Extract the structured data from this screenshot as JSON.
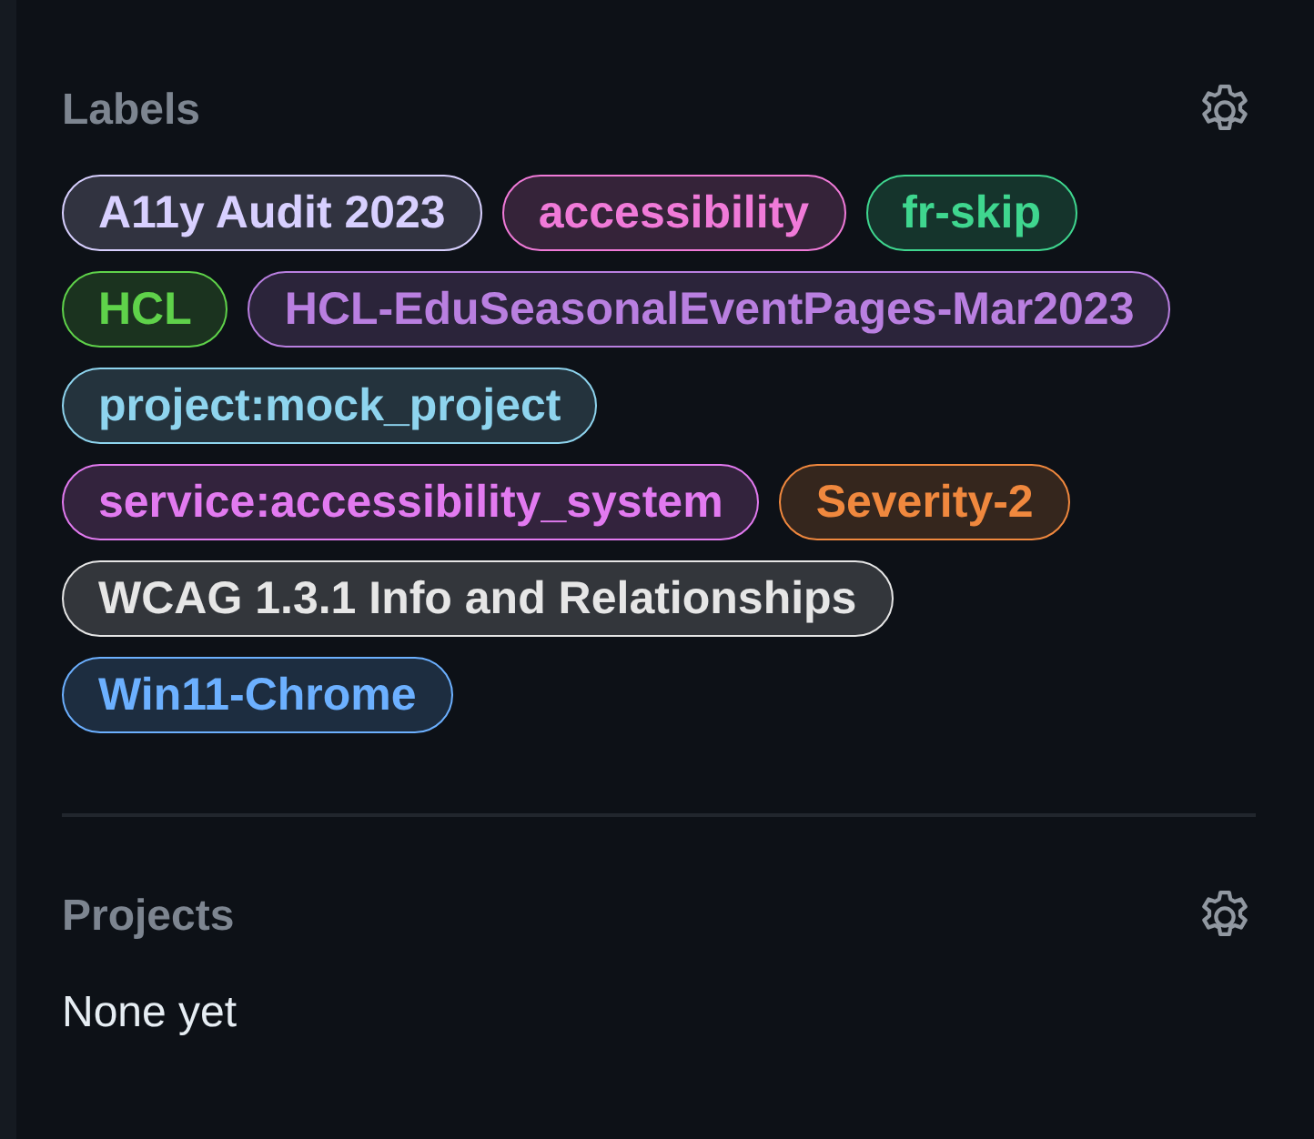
{
  "labels_section": {
    "title": "Labels",
    "labels": [
      {
        "name": "A11y Audit 2023",
        "color": "#d8d0ff"
      },
      {
        "name": "accessibility",
        "color": "#f07ad8"
      },
      {
        "name": "fr-skip",
        "color": "#3fd68f"
      },
      {
        "name": "HCL",
        "color": "#5fd24a"
      },
      {
        "name": "HCL-EduSeasonalEventPages-Mar2023",
        "color": "#b97fe0"
      },
      {
        "name": "project:mock_project",
        "color": "#8ed4ee"
      },
      {
        "name": "service:accessibility_system",
        "color": "#e27af0"
      },
      {
        "name": "Severity-2",
        "color": "#f0883e"
      },
      {
        "name": "WCAG 1.3.1 Info and Relationships",
        "color": "#e6e6e6"
      },
      {
        "name": "Win11-Chrome",
        "color": "#6cb0ff"
      }
    ]
  },
  "projects_section": {
    "title": "Projects",
    "empty_text": "None yet"
  }
}
